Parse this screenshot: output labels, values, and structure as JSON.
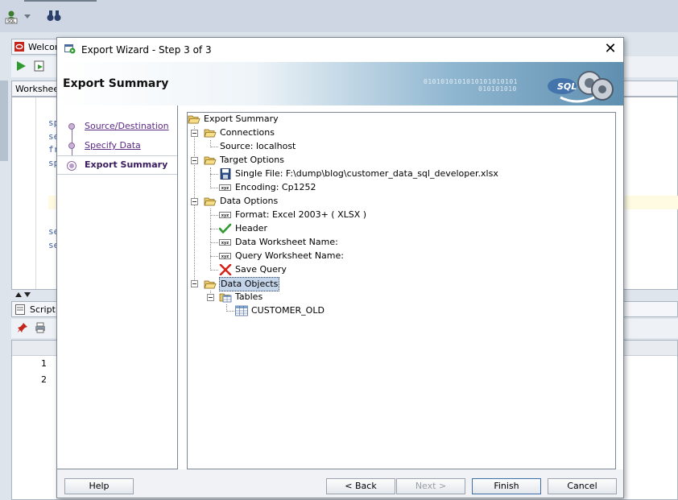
{
  "background": {
    "document_tab": "Welcom",
    "worksheet_tab": "Worksheet",
    "script_tab": "Script O",
    "code_lines": [
      "sp",
      "se",
      "fr",
      "sp",
      "",
      "",
      "",
      "",
      "se",
      "se"
    ],
    "grid_rows": [
      "1",
      "2"
    ]
  },
  "dialog": {
    "title": "Export Wizard - Step 3 of 3",
    "close_glyph": "✕",
    "banner": {
      "title": "Export Summary",
      "digits_line1": "0101010101010101010101",
      "digits_line2": "010101010",
      "art_label": "SQL"
    },
    "steps": [
      {
        "label": "Source/Destination",
        "state": "link"
      },
      {
        "label": "Specify Data",
        "state": "link"
      },
      {
        "label": "Export Summary",
        "state": "active"
      }
    ],
    "tree": {
      "root": "Export Summary",
      "connections": {
        "label": "Connections",
        "source": "Source: localhost"
      },
      "target_options": {
        "label": "Target Options",
        "single_file": "Single File: F:\\dump\\blog\\customer_data_sql_developer.xlsx",
        "encoding": "Encoding: Cp1252"
      },
      "data_options": {
        "label": "Data Options",
        "format": "Format: Excel 2003+ ( XLSX )",
        "header": "Header",
        "data_worksheet": "Data Worksheet Name:",
        "query_worksheet": "Query Worksheet Name:",
        "save_query": "Save Query"
      },
      "data_objects": {
        "label": "Data Objects",
        "tables": "Tables",
        "table": "CUSTOMER_OLD"
      },
      "badge_text": "xyz"
    },
    "buttons": {
      "help": "Help",
      "back": "< Back",
      "next": "Next >",
      "finish": "Finish",
      "cancel": "Cancel"
    }
  },
  "colors": {
    "step_link": "#5b2a84",
    "selection": "#c4d5ea",
    "banner_end": "#5f8fb0"
  }
}
